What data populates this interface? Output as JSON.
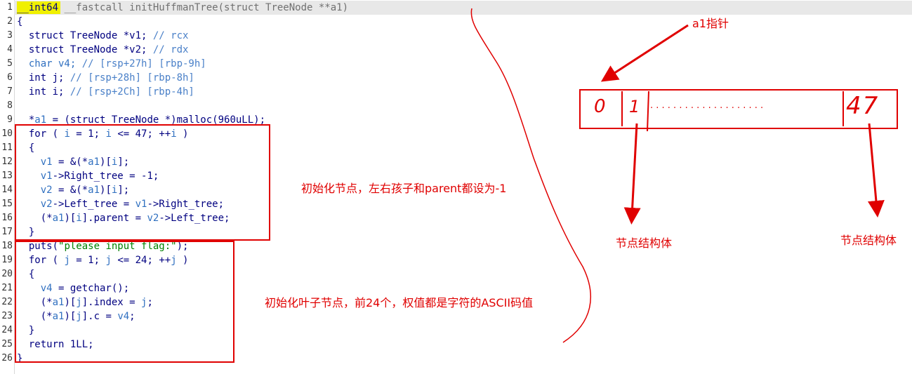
{
  "code_lines": [
    {
      "n": "1",
      "segments": [
        {
          "t": "__int64",
          "c": "kw"
        },
        {
          "t": " __fastcall initHuffmanTree(struct TreeNode **a1)",
          "c": "gray"
        }
      ]
    },
    {
      "n": "2",
      "segments": [
        {
          "t": "{",
          "c": "kw"
        }
      ]
    },
    {
      "n": "3",
      "segments": [
        {
          "t": "  struct TreeNode *v1; ",
          "c": "kw"
        },
        {
          "t": "// rcx",
          "c": "cm"
        }
      ]
    },
    {
      "n": "4",
      "segments": [
        {
          "t": "  struct TreeNode *v2; ",
          "c": "kw"
        },
        {
          "t": "// rdx",
          "c": "cm"
        }
      ]
    },
    {
      "n": "5",
      "segments": [
        {
          "t": "  char v4; ",
          "c": "var"
        },
        {
          "t": "// [rsp+27h] [rbp-9h]",
          "c": "cm"
        }
      ]
    },
    {
      "n": "6",
      "segments": [
        {
          "t": "  int j; ",
          "c": "kw"
        },
        {
          "t": "// [rsp+28h] [rbp-8h]",
          "c": "cm"
        }
      ]
    },
    {
      "n": "7",
      "segments": [
        {
          "t": "  int i; ",
          "c": "kw"
        },
        {
          "t": "// [rsp+2Ch] [rbp-4h]",
          "c": "cm"
        }
      ]
    },
    {
      "n": "8",
      "segments": [
        {
          "t": "",
          "c": "kw"
        }
      ]
    },
    {
      "n": "9",
      "segments": [
        {
          "t": "  *",
          "c": "kw"
        },
        {
          "t": "a1",
          "c": "var"
        },
        {
          "t": " = (struct TreeNode *)malloc(960uLL);",
          "c": "kw"
        }
      ]
    },
    {
      "n": "10",
      "segments": [
        {
          "t": "  for ( ",
          "c": "kw"
        },
        {
          "t": "i",
          "c": "var"
        },
        {
          "t": " = 1; ",
          "c": "kw"
        },
        {
          "t": "i",
          "c": "var"
        },
        {
          "t": " <= 47; ++",
          "c": "kw"
        },
        {
          "t": "i",
          "c": "var"
        },
        {
          "t": " )",
          "c": "kw"
        }
      ]
    },
    {
      "n": "11",
      "segments": [
        {
          "t": "  {",
          "c": "kw"
        }
      ]
    },
    {
      "n": "12",
      "segments": [
        {
          "t": "    ",
          "c": "kw"
        },
        {
          "t": "v1",
          "c": "var"
        },
        {
          "t": " = &(*",
          "c": "kw"
        },
        {
          "t": "a1",
          "c": "var"
        },
        {
          "t": ")[",
          "c": "kw"
        },
        {
          "t": "i",
          "c": "var"
        },
        {
          "t": "];",
          "c": "kw"
        }
      ]
    },
    {
      "n": "13",
      "segments": [
        {
          "t": "    ",
          "c": "kw"
        },
        {
          "t": "v1",
          "c": "var"
        },
        {
          "t": "->Right_tree = -1;",
          "c": "kw"
        }
      ]
    },
    {
      "n": "14",
      "segments": [
        {
          "t": "    ",
          "c": "kw"
        },
        {
          "t": "v2",
          "c": "var"
        },
        {
          "t": " = &(*",
          "c": "kw"
        },
        {
          "t": "a1",
          "c": "var"
        },
        {
          "t": ")[",
          "c": "kw"
        },
        {
          "t": "i",
          "c": "var"
        },
        {
          "t": "];",
          "c": "kw"
        }
      ]
    },
    {
      "n": "15",
      "segments": [
        {
          "t": "    ",
          "c": "kw"
        },
        {
          "t": "v2",
          "c": "var"
        },
        {
          "t": "->Left_tree = ",
          "c": "kw"
        },
        {
          "t": "v1",
          "c": "var"
        },
        {
          "t": "->Right_tree;",
          "c": "kw"
        }
      ]
    },
    {
      "n": "16",
      "segments": [
        {
          "t": "    (*",
          "c": "kw"
        },
        {
          "t": "a1",
          "c": "var"
        },
        {
          "t": ")[",
          "c": "kw"
        },
        {
          "t": "i",
          "c": "var"
        },
        {
          "t": "].parent = ",
          "c": "kw"
        },
        {
          "t": "v2",
          "c": "var"
        },
        {
          "t": "->Left_tree;",
          "c": "kw"
        }
      ]
    },
    {
      "n": "17",
      "segments": [
        {
          "t": "  }",
          "c": "kw"
        }
      ]
    },
    {
      "n": "18",
      "segments": [
        {
          "t": "  puts(",
          "c": "kw"
        },
        {
          "t": "\"please input flag:\"",
          "c": "str"
        },
        {
          "t": ");",
          "c": "kw"
        }
      ]
    },
    {
      "n": "19",
      "segments": [
        {
          "t": "  for ( ",
          "c": "kw"
        },
        {
          "t": "j",
          "c": "var"
        },
        {
          "t": " = 1; ",
          "c": "kw"
        },
        {
          "t": "j",
          "c": "var"
        },
        {
          "t": " <= 24; ++",
          "c": "kw"
        },
        {
          "t": "j",
          "c": "var"
        },
        {
          "t": " )",
          "c": "kw"
        }
      ]
    },
    {
      "n": "20",
      "segments": [
        {
          "t": "  {",
          "c": "kw"
        }
      ]
    },
    {
      "n": "21",
      "segments": [
        {
          "t": "    ",
          "c": "kw"
        },
        {
          "t": "v4",
          "c": "var"
        },
        {
          "t": " = getchar();",
          "c": "kw"
        }
      ]
    },
    {
      "n": "22",
      "segments": [
        {
          "t": "    (*",
          "c": "kw"
        },
        {
          "t": "a1",
          "c": "var"
        },
        {
          "t": ")[",
          "c": "kw"
        },
        {
          "t": "j",
          "c": "var"
        },
        {
          "t": "].index = ",
          "c": "kw"
        },
        {
          "t": "j",
          "c": "var"
        },
        {
          "t": ";",
          "c": "kw"
        }
      ]
    },
    {
      "n": "23",
      "segments": [
        {
          "t": "    (*",
          "c": "kw"
        },
        {
          "t": "a1",
          "c": "var"
        },
        {
          "t": ")[",
          "c": "kw"
        },
        {
          "t": "j",
          "c": "var"
        },
        {
          "t": "].c = ",
          "c": "kw"
        },
        {
          "t": "v4",
          "c": "var"
        },
        {
          "t": ";",
          "c": "kw"
        }
      ]
    },
    {
      "n": "24",
      "segments": [
        {
          "t": "  }",
          "c": "kw"
        }
      ]
    },
    {
      "n": "25",
      "segments": [
        {
          "t": "  return 1LL;",
          "c": "kw"
        }
      ]
    },
    {
      "n": "26",
      "segments": [
        {
          "t": "}",
          "c": "kw"
        }
      ]
    }
  ],
  "annotations": {
    "init_nodes": "初始化节点，左右孩子和parent都设为-1",
    "init_leaves": "初始化叶子节点，前24个，权值都是字符的ASCII码值",
    "pointer_label": "a1指针",
    "node_struct_left": "节点结构体",
    "node_struct_right": "节点结构体",
    "array_first": "0",
    "array_second": "1",
    "array_dots": ". . . . .  . .  . .  . .   . . .  . . . . . .",
    "array_last": "47"
  },
  "colors": {
    "annotation_red": "#e00000",
    "line_highlight": "#f0f000",
    "keyword_navy": "#000080",
    "variable_blue": "#3070c0",
    "string_green": "#008000"
  }
}
